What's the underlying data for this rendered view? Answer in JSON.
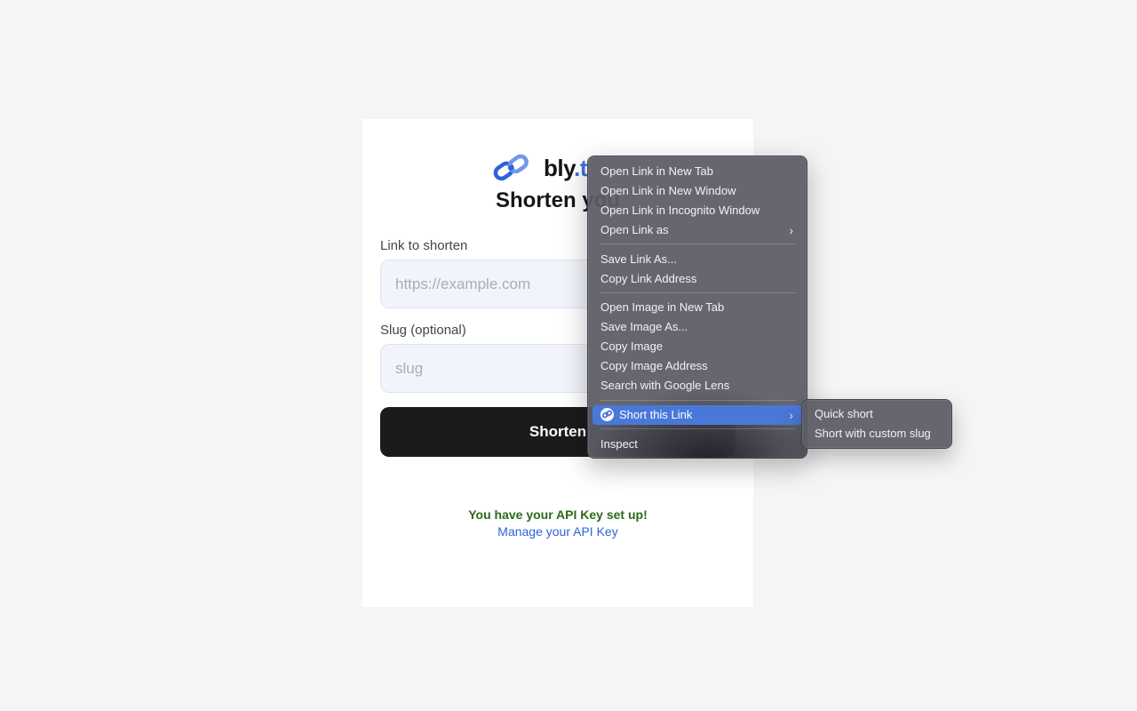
{
  "app": {
    "logo_name": "bly",
    "logo_tld": ".t",
    "headline": "Shorten you",
    "colors": {
      "accent": "#3b6fe0",
      "button": "#1b1b1b",
      "success": "#2c6a16",
      "link": "#2f64d8"
    }
  },
  "form": {
    "link_label": "Link to shorten",
    "link_placeholder": "https://example.com",
    "slug_label": "Slug (optional)",
    "slug_placeholder": "slug",
    "submit_label": "Shorten"
  },
  "api": {
    "status": "You have your API Key set up!",
    "manage_link": "Manage your API Key"
  },
  "context_menu": {
    "items": [
      {
        "label": "Open Link in New Tab"
      },
      {
        "label": "Open Link in New Window"
      },
      {
        "label": "Open Link in Incognito Window"
      },
      {
        "label": "Open Link as",
        "submenu": true
      },
      {
        "label": "Save Link As..."
      },
      {
        "label": "Copy Link Address"
      },
      {
        "label": "Open Image in New Tab"
      },
      {
        "label": "Save Image As..."
      },
      {
        "label": "Copy Image"
      },
      {
        "label": "Copy Image Address"
      },
      {
        "label": "Search with Google Lens"
      },
      {
        "label": "Short this Link",
        "submenu": true,
        "highlighted": true,
        "icon": "bly-extension-icon"
      },
      {
        "label": "Inspect"
      }
    ],
    "chevron": "›"
  },
  "submenu": {
    "items": [
      {
        "label": "Quick short"
      },
      {
        "label": "Short with custom slug"
      }
    ]
  }
}
